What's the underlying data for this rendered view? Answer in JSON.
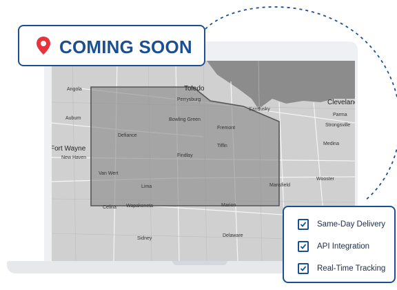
{
  "badge": {
    "text": "COMING SOON",
    "icon": "location-pin-icon",
    "accent": "#1b4f8f",
    "pin_color": "#e8323c"
  },
  "features": [
    {
      "label": "Same-Day Delivery",
      "icon": "checkbox-checked-icon"
    },
    {
      "label": "API Integration",
      "icon": "checkbox-checked-icon"
    },
    {
      "label": "Real-Time Tracking",
      "icon": "checkbox-checked-icon"
    }
  ],
  "map": {
    "cities": [
      "Angola",
      "Toledo",
      "Perrysburg",
      "Sandusky",
      "Cleveland",
      "Parma",
      "Strongsville",
      "Auburn",
      "Bowling Green",
      "Fremont",
      "Defiance",
      "Medina",
      "Fort Wayne",
      "New Haven",
      "Tiffin",
      "Van Wert",
      "Findlay",
      "Wooster",
      "Lima",
      "Mansfield",
      "Celina",
      "Wapakoneta",
      "Marion",
      "Sidney",
      "Delaware"
    ]
  }
}
